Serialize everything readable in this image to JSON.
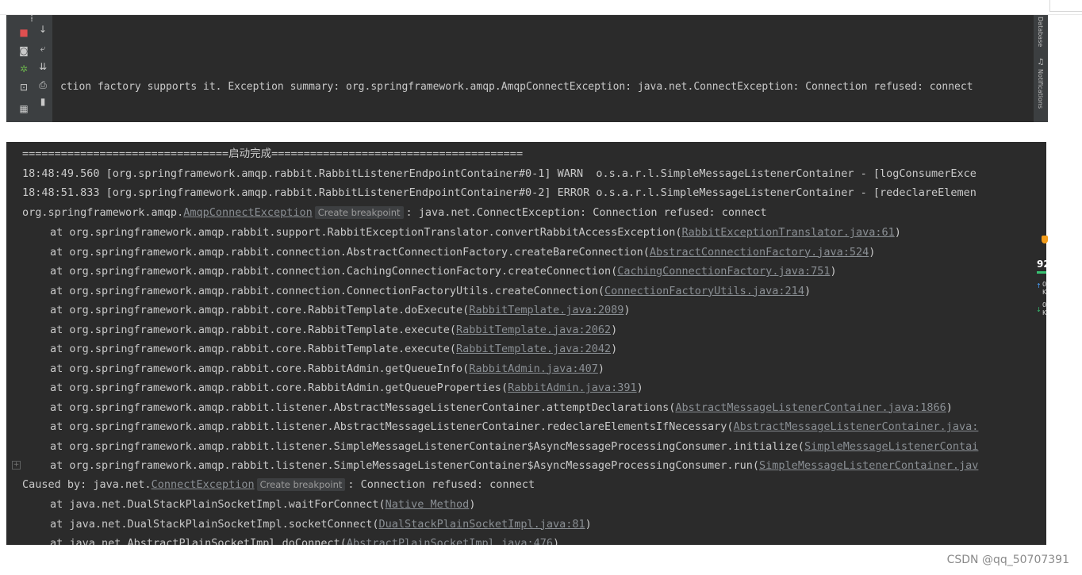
{
  "top_panel": {
    "log_line": "ction factory supports it. Exception summary: org.springframework.amqp.AmqpConnectException: java.net.ConnectException: Connection refused: connect",
    "side_labels": {
      "database": "Database",
      "notifications": "Notifications"
    }
  },
  "console": {
    "separator": "================================启动完成=======================================",
    "warn_line": "18:48:49.560 [org.springframework.amqp.rabbit.RabbitListenerEndpointContainer#0-1] WARN  o.s.a.r.l.SimpleMessageListenerContainer - [logConsumerExce",
    "error_line": "18:48:51.833 [org.springframework.amqp.rabbit.RabbitListenerEndpointContainer#0-2] ERROR o.s.a.r.l.SimpleMessageListenerContainer - [redeclareElemen",
    "exception_line": {
      "prefix": "org.springframework.amqp.",
      "link": "AmqpConnectException",
      "badge": "Create breakpoint",
      "suffix": ": java.net.ConnectException: Connection refused: connect"
    },
    "stack": [
      {
        "prefix": "at org.springframework.amqp.rabbit.support.RabbitExceptionTranslator.convertRabbitAccessException(",
        "link": "RabbitExceptionTranslator.java:61",
        "suffix": ")"
      },
      {
        "prefix": "at org.springframework.amqp.rabbit.connection.AbstractConnectionFactory.createBareConnection(",
        "link": "AbstractConnectionFactory.java:524",
        "suffix": ")"
      },
      {
        "prefix": "at org.springframework.amqp.rabbit.connection.CachingConnectionFactory.createConnection(",
        "link": "CachingConnectionFactory.java:751",
        "suffix": ")"
      },
      {
        "prefix": "at org.springframework.amqp.rabbit.connection.ConnectionFactoryUtils.createConnection(",
        "link": "ConnectionFactoryUtils.java:214",
        "suffix": ")"
      },
      {
        "prefix": "at org.springframework.amqp.rabbit.core.RabbitTemplate.doExecute(",
        "link": "RabbitTemplate.java:2089",
        "suffix": ")"
      },
      {
        "prefix": "at org.springframework.amqp.rabbit.core.RabbitTemplate.execute(",
        "link": "RabbitTemplate.java:2062",
        "suffix": ")"
      },
      {
        "prefix": "at org.springframework.amqp.rabbit.core.RabbitTemplate.execute(",
        "link": "RabbitTemplate.java:2042",
        "suffix": ")"
      },
      {
        "prefix": "at org.springframework.amqp.rabbit.core.RabbitAdmin.getQueueInfo(",
        "link": "RabbitAdmin.java:407",
        "suffix": ")"
      },
      {
        "prefix": "at org.springframework.amqp.rabbit.core.RabbitAdmin.getQueueProperties(",
        "link": "RabbitAdmin.java:391",
        "suffix": ")"
      },
      {
        "prefix": "at org.springframework.amqp.rabbit.listener.AbstractMessageListenerContainer.attemptDeclarations(",
        "link": "AbstractMessageListenerContainer.java:1866",
        "suffix": ")"
      },
      {
        "prefix": "at org.springframework.amqp.rabbit.listener.AbstractMessageListenerContainer.redeclareElementsIfNecessary(",
        "link": "AbstractMessageListenerContainer.java:",
        "suffix": ""
      },
      {
        "prefix": "at org.springframework.amqp.rabbit.listener.SimpleMessageListenerContainer$AsyncMessageProcessingConsumer.initialize(",
        "link": "SimpleMessageListenerContai",
        "suffix": ""
      },
      {
        "prefix": "at org.springframework.amqp.rabbit.listener.SimpleMessageListenerContainer$AsyncMessageProcessingConsumer.run(",
        "link": "SimpleMessageListenerContainer.jav",
        "suffix": ""
      }
    ],
    "caused_by": {
      "prefix": "Caused by: java.net.",
      "link": "ConnectException",
      "badge": "Create breakpoint",
      "suffix": ": Connection refused: connect"
    },
    "caused_stack": [
      {
        "prefix": "at java.net.DualStackPlainSocketImpl.waitForConnect(",
        "link": "Native Method",
        "suffix": ")"
      },
      {
        "prefix": "at java.net.DualStackPlainSocketImpl.socketConnect(",
        "link": "DualStackPlainSocketImpl.java:81",
        "suffix": ")"
      },
      {
        "prefix": "at java.net.AbstractPlainSocketImpl.doConnect(",
        "link": "AbstractPlainSocketImpl.java:476",
        "suffix": ")"
      }
    ]
  },
  "widget": {
    "value": "92",
    "line1": "0",
    "line1b": "K",
    "line2": "0",
    "line2b": "K",
    "accent": "#f39c1a",
    "bar_color": "#38c172"
  },
  "watermark": "CSDN @qq_50707391",
  "colors": {
    "console_bg": "#2b2b2b",
    "toolbar_bg": "#3c3f41",
    "text": "#c9c9c9",
    "link": "#8a8f94"
  }
}
